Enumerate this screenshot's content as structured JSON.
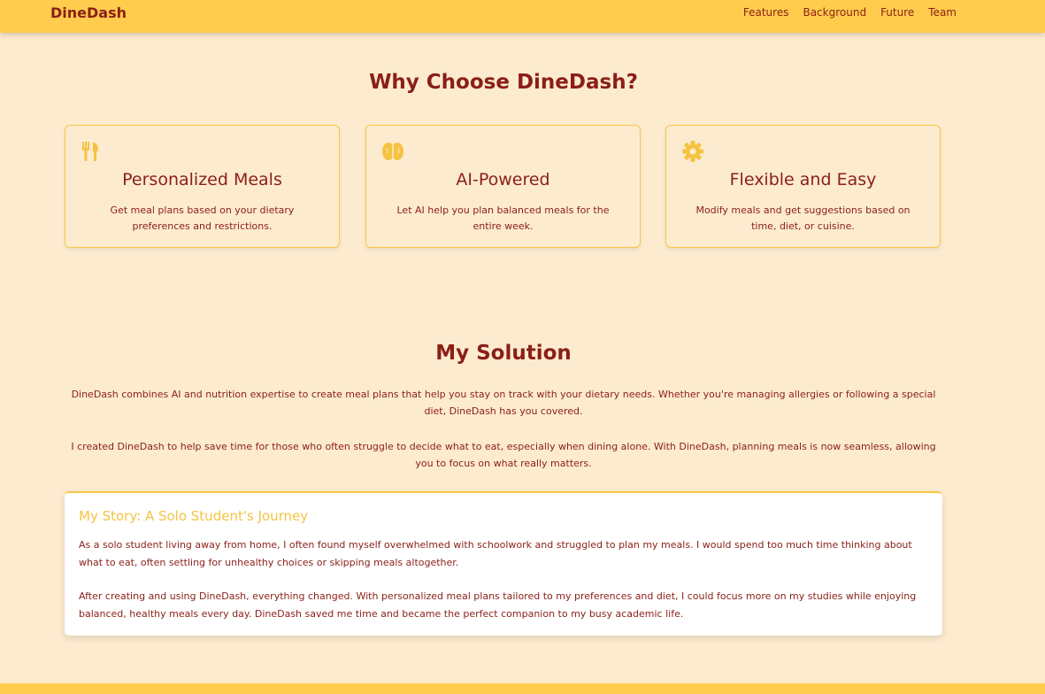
{
  "header": {
    "brand": "DineDash",
    "nav": [
      "Features",
      "Background",
      "Future",
      "Team"
    ]
  },
  "features": {
    "title": "Why Choose DineDash?",
    "cards": [
      {
        "icon": "utensils-icon",
        "title": "Personalized Meals",
        "text": "Get meal plans based on your dietary preferences and restrictions."
      },
      {
        "icon": "brain-icon",
        "title": "AI-Powered",
        "text": "Let AI help you plan balanced meals for the entire week."
      },
      {
        "icon": "gear-icon",
        "title": "Flexible and Easy",
        "text": "Modify meals and get suggestions based on time, diet, or cuisine."
      }
    ]
  },
  "solution": {
    "title": "My Solution",
    "paragraphs": [
      "DineDash combines AI and nutrition expertise to create meal plans that help you stay on track with your dietary needs. Whether you're managing allergies or following a special diet, DineDash has you covered.",
      "I created DineDash to help save time for those who often struggle to decide what to eat, especially when dining alone. With DineDash, planning meals is now seamless, allowing you to focus on what really matters."
    ]
  },
  "story": {
    "title": "My Story: A Solo Student's Journey",
    "paragraphs": [
      "As a solo student living away from home, I often found myself overwhelmed with schoolwork and struggled to plan my meals. I would spend too much time thinking about what to eat, often settling for unhealthy choices or skipping meals altogether.",
      "After creating and using DineDash, everything changed. With personalized meal plans tailored to my preferences and diet, I could focus more on my studies while enjoying balanced, healthy meals every day. DineDash saved me time and became the perfect companion to my busy academic life."
    ]
  },
  "colors": {
    "background": "#fdebcf",
    "header": "#ffcc4d",
    "text": "#8a1f17",
    "accent": "#f5c342"
  }
}
